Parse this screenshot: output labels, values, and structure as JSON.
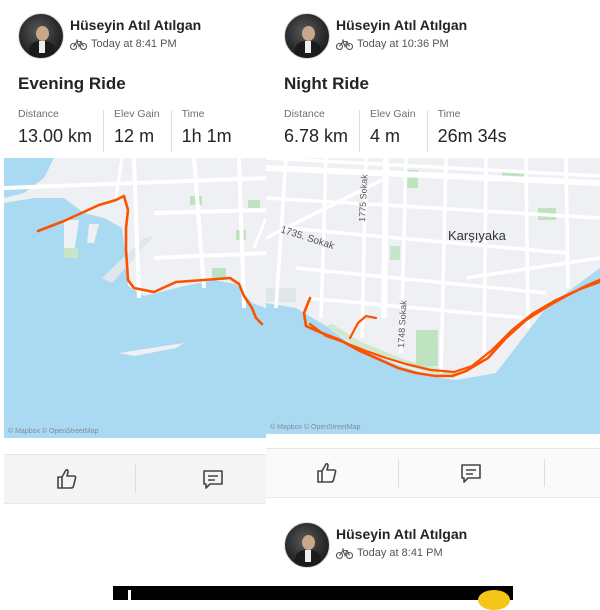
{
  "left": {
    "user_name": "Hüseyin Atıl Atılgan",
    "timestamp": "Today at 8:41 PM",
    "activity_type_icon": "bike-icon",
    "title": "Evening Ride",
    "stats": [
      {
        "label": "Distance",
        "value": "13.00 km"
      },
      {
        "label": "Elev Gain",
        "value": "12 m"
      },
      {
        "label": "Time",
        "value": "1h 1m"
      }
    ],
    "map_attribution": "© Mapbox © OpenStreetMap",
    "actions": [
      "like-icon",
      "comment-icon"
    ]
  },
  "right": {
    "user_name": "Hüseyin Atıl Atılgan",
    "timestamp": "Today at 10:36 PM",
    "activity_type_icon": "bike-icon",
    "title": "Night Ride",
    "stats": [
      {
        "label": "Distance",
        "value": "6.78 km"
      },
      {
        "label": "Elev Gain",
        "value": "4 m"
      },
      {
        "label": "Time",
        "value": "26m 34s"
      }
    ],
    "map_labels": {
      "district": "Karşıyaka",
      "street_1735": "1735. Sokak",
      "street_1775": "1775 Sokak",
      "street_1748": "1748 Sokak"
    },
    "map_attribution": "© Mapbox © OpenStreetMap",
    "actions": [
      "like-icon",
      "comment-icon"
    ]
  },
  "next_card": {
    "user_name": "Hüseyin Atıl Atılgan",
    "timestamp": "Today at 8:41 PM"
  },
  "colors": {
    "route": "#fc5200",
    "water": "#aadaf2",
    "land": "#eef0f3",
    "park": "#bfe3c0",
    "road": "#ffffff"
  }
}
